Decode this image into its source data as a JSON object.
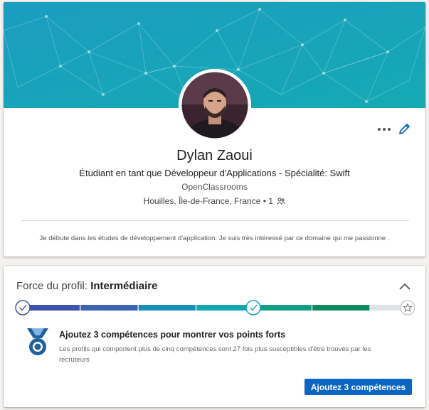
{
  "profile": {
    "name": "Dylan Zaoui",
    "headline": "Étudiant en tant que Développeur d'Applications - Spécialité: Swift",
    "company": "OpenClassrooms",
    "location": "Houilles, Île-de-France, France",
    "separator": "•",
    "connections": "1",
    "summary": "Je débute dans les études de développement d'application. Je suis très intéressé par ce domaine qui me passionne .",
    "icons": {
      "more": "more-horizontal-icon",
      "edit": "pencil-icon",
      "connections": "people-icon"
    }
  },
  "strength": {
    "label": "Force du profil:",
    "level": "Intermédiaire",
    "progress_fraction": 0.6,
    "task_title": "Ajoutez 3 compétences pour montrer vos points forts",
    "task_description": "Les profils qui comportent plus de cinq compétences sont 27 fois plus susceptibles d'être trouvés par les recruteurs",
    "cta_label": "Ajoutez 3 compétences",
    "icons": {
      "collapse": "chevron-up-icon",
      "badge": "skill-badge-icon",
      "goal": "star-icon"
    }
  },
  "colors": {
    "banner": "#1aa1b8",
    "accent": "#0a66c2",
    "meter_blue": "#3c54a8",
    "meter_teal": "#11a6b0",
    "meter_green": "#0f8a5f"
  }
}
